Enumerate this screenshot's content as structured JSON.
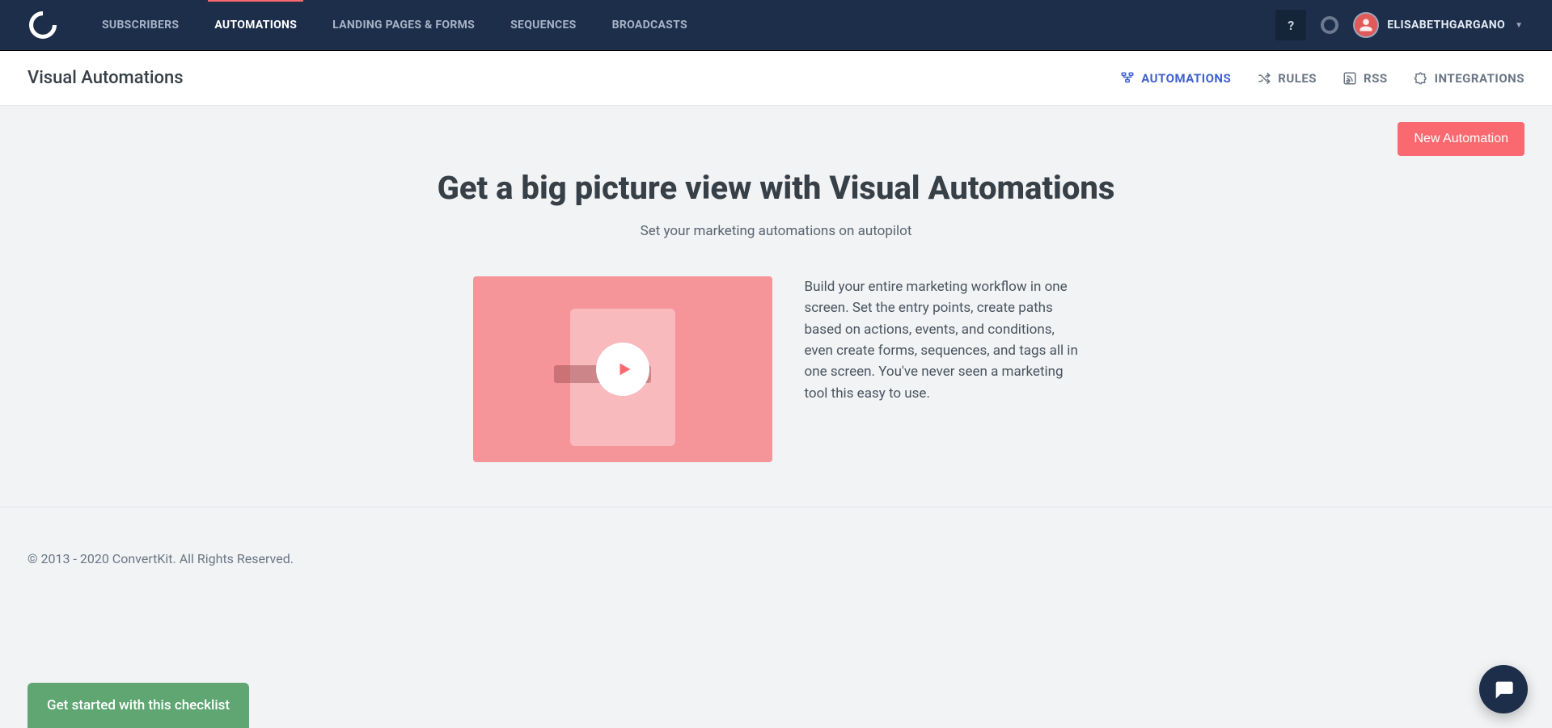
{
  "nav": {
    "items": [
      {
        "label": "SUBSCRIBERS"
      },
      {
        "label": "AUTOMATIONS"
      },
      {
        "label": "LANDING PAGES & FORMS"
      },
      {
        "label": "SEQUENCES"
      },
      {
        "label": "BROADCASTS"
      }
    ],
    "active_index": 1
  },
  "header_right": {
    "help_label": "?",
    "user_name": "ELISABETHGARGANO"
  },
  "subheader": {
    "page_title": "Visual Automations",
    "tabs": [
      {
        "label": "AUTOMATIONS"
      },
      {
        "label": "RULES"
      },
      {
        "label": "RSS"
      },
      {
        "label": "INTEGRATIONS"
      }
    ],
    "active_index": 0
  },
  "actions": {
    "new_button": "New Automation"
  },
  "hero": {
    "title": "Get a big picture view with Visual Automations",
    "subtitle": "Set your marketing automations on autopilot",
    "body": "Build your entire marketing workflow in one screen. Set the entry points, create paths based on actions, events, and conditions, even create forms, sequences, and tags all in one screen. You've never seen a marketing tool this easy to use."
  },
  "footer": {
    "copyright": "© 2013 - 2020 ConvertKit. All Rights Reserved."
  },
  "checklist": {
    "label": "Get started with this checklist"
  }
}
